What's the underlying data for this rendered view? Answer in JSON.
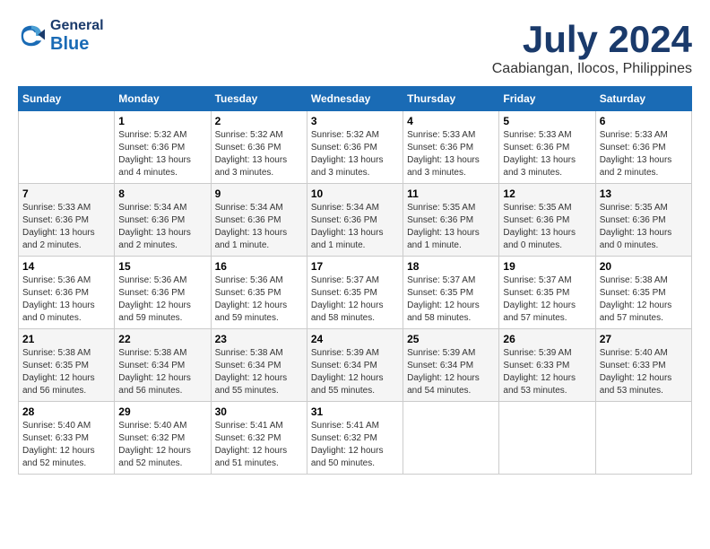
{
  "header": {
    "logo": {
      "general": "General",
      "blue": "Blue"
    },
    "title": "July 2024",
    "location": "Caabiangan, Ilocos, Philippines"
  },
  "calendar": {
    "headers": [
      "Sunday",
      "Monday",
      "Tuesday",
      "Wednesday",
      "Thursday",
      "Friday",
      "Saturday"
    ],
    "weeks": [
      [
        {
          "day": "",
          "info": ""
        },
        {
          "day": "1",
          "info": "Sunrise: 5:32 AM\nSunset: 6:36 PM\nDaylight: 13 hours\nand 4 minutes."
        },
        {
          "day": "2",
          "info": "Sunrise: 5:32 AM\nSunset: 6:36 PM\nDaylight: 13 hours\nand 3 minutes."
        },
        {
          "day": "3",
          "info": "Sunrise: 5:32 AM\nSunset: 6:36 PM\nDaylight: 13 hours\nand 3 minutes."
        },
        {
          "day": "4",
          "info": "Sunrise: 5:33 AM\nSunset: 6:36 PM\nDaylight: 13 hours\nand 3 minutes."
        },
        {
          "day": "5",
          "info": "Sunrise: 5:33 AM\nSunset: 6:36 PM\nDaylight: 13 hours\nand 3 minutes."
        },
        {
          "day": "6",
          "info": "Sunrise: 5:33 AM\nSunset: 6:36 PM\nDaylight: 13 hours\nand 2 minutes."
        }
      ],
      [
        {
          "day": "7",
          "info": "Sunrise: 5:33 AM\nSunset: 6:36 PM\nDaylight: 13 hours\nand 2 minutes."
        },
        {
          "day": "8",
          "info": "Sunrise: 5:34 AM\nSunset: 6:36 PM\nDaylight: 13 hours\nand 2 minutes."
        },
        {
          "day": "9",
          "info": "Sunrise: 5:34 AM\nSunset: 6:36 PM\nDaylight: 13 hours\nand 1 minute."
        },
        {
          "day": "10",
          "info": "Sunrise: 5:34 AM\nSunset: 6:36 PM\nDaylight: 13 hours\nand 1 minute."
        },
        {
          "day": "11",
          "info": "Sunrise: 5:35 AM\nSunset: 6:36 PM\nDaylight: 13 hours\nand 1 minute."
        },
        {
          "day": "12",
          "info": "Sunrise: 5:35 AM\nSunset: 6:36 PM\nDaylight: 13 hours\nand 0 minutes."
        },
        {
          "day": "13",
          "info": "Sunrise: 5:35 AM\nSunset: 6:36 PM\nDaylight: 13 hours\nand 0 minutes."
        }
      ],
      [
        {
          "day": "14",
          "info": "Sunrise: 5:36 AM\nSunset: 6:36 PM\nDaylight: 13 hours\nand 0 minutes."
        },
        {
          "day": "15",
          "info": "Sunrise: 5:36 AM\nSunset: 6:36 PM\nDaylight: 12 hours\nand 59 minutes."
        },
        {
          "day": "16",
          "info": "Sunrise: 5:36 AM\nSunset: 6:35 PM\nDaylight: 12 hours\nand 59 minutes."
        },
        {
          "day": "17",
          "info": "Sunrise: 5:37 AM\nSunset: 6:35 PM\nDaylight: 12 hours\nand 58 minutes."
        },
        {
          "day": "18",
          "info": "Sunrise: 5:37 AM\nSunset: 6:35 PM\nDaylight: 12 hours\nand 58 minutes."
        },
        {
          "day": "19",
          "info": "Sunrise: 5:37 AM\nSunset: 6:35 PM\nDaylight: 12 hours\nand 57 minutes."
        },
        {
          "day": "20",
          "info": "Sunrise: 5:38 AM\nSunset: 6:35 PM\nDaylight: 12 hours\nand 57 minutes."
        }
      ],
      [
        {
          "day": "21",
          "info": "Sunrise: 5:38 AM\nSunset: 6:35 PM\nDaylight: 12 hours\nand 56 minutes."
        },
        {
          "day": "22",
          "info": "Sunrise: 5:38 AM\nSunset: 6:34 PM\nDaylight: 12 hours\nand 56 minutes."
        },
        {
          "day": "23",
          "info": "Sunrise: 5:38 AM\nSunset: 6:34 PM\nDaylight: 12 hours\nand 55 minutes."
        },
        {
          "day": "24",
          "info": "Sunrise: 5:39 AM\nSunset: 6:34 PM\nDaylight: 12 hours\nand 55 minutes."
        },
        {
          "day": "25",
          "info": "Sunrise: 5:39 AM\nSunset: 6:34 PM\nDaylight: 12 hours\nand 54 minutes."
        },
        {
          "day": "26",
          "info": "Sunrise: 5:39 AM\nSunset: 6:33 PM\nDaylight: 12 hours\nand 53 minutes."
        },
        {
          "day": "27",
          "info": "Sunrise: 5:40 AM\nSunset: 6:33 PM\nDaylight: 12 hours\nand 53 minutes."
        }
      ],
      [
        {
          "day": "28",
          "info": "Sunrise: 5:40 AM\nSunset: 6:33 PM\nDaylight: 12 hours\nand 52 minutes."
        },
        {
          "day": "29",
          "info": "Sunrise: 5:40 AM\nSunset: 6:32 PM\nDaylight: 12 hours\nand 52 minutes."
        },
        {
          "day": "30",
          "info": "Sunrise: 5:41 AM\nSunset: 6:32 PM\nDaylight: 12 hours\nand 51 minutes."
        },
        {
          "day": "31",
          "info": "Sunrise: 5:41 AM\nSunset: 6:32 PM\nDaylight: 12 hours\nand 50 minutes."
        },
        {
          "day": "",
          "info": ""
        },
        {
          "day": "",
          "info": ""
        },
        {
          "day": "",
          "info": ""
        }
      ]
    ]
  }
}
